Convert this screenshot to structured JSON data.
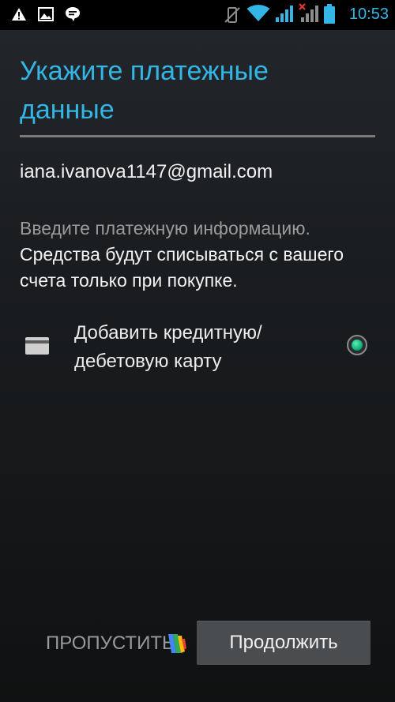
{
  "status_bar": {
    "time": "10:53",
    "icons": [
      "warning-icon",
      "image-icon",
      "chat-icon",
      "vibrate-off-icon",
      "wifi-icon",
      "signal-icon",
      "signal-no-data-icon",
      "battery-icon"
    ],
    "accent": "#33b5e5"
  },
  "page": {
    "title": "Укажите платежные данные",
    "account_email": "iana.ivanova1147@gmail.com",
    "info_muted": "Введите платежную информацию.",
    "info_bright": "Средства будут списываться с вашего счета только при покупке."
  },
  "payment_option": {
    "icon": "credit-card-icon",
    "label": "Добавить кредитную/ дебетовую карту",
    "selected": true
  },
  "footer": {
    "skip_label": "ПРОПУСТИТЬ",
    "continue_label": "Продолжить",
    "logo_icon": "google-wallet-icon"
  }
}
